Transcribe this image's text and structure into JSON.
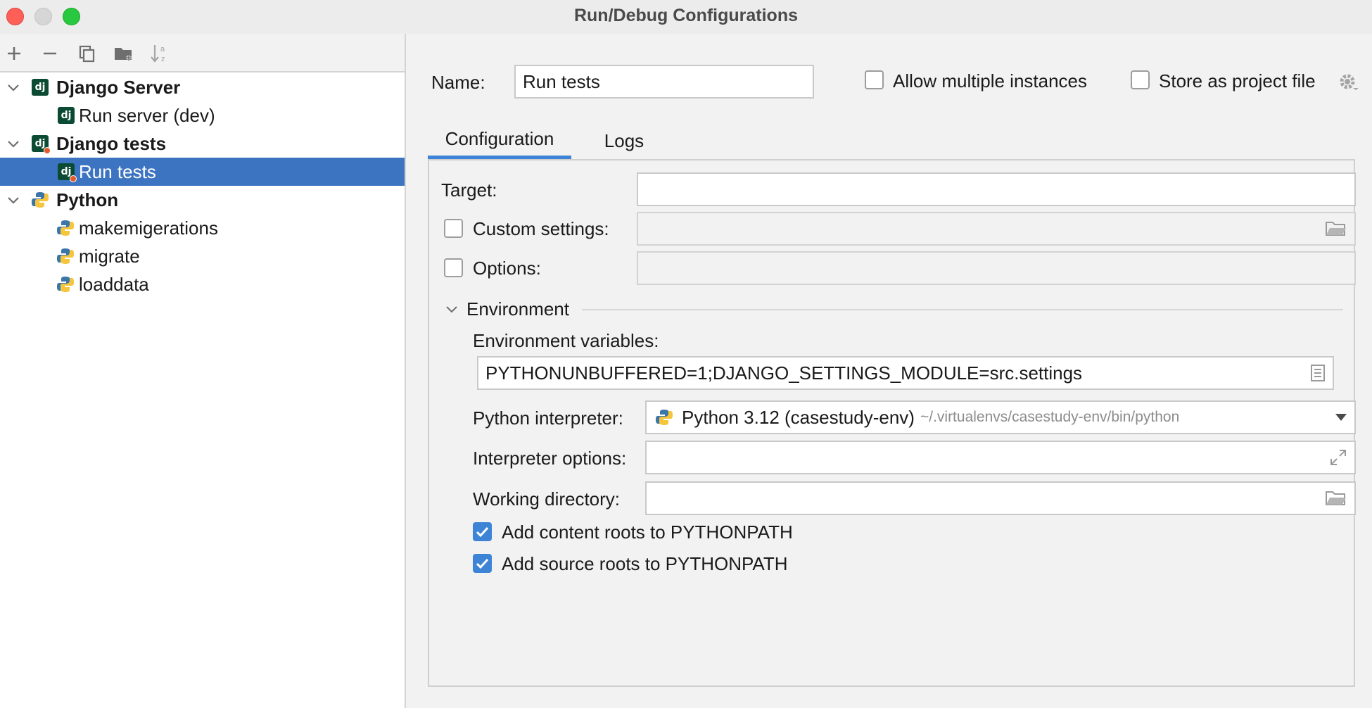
{
  "window": {
    "title": "Run/Debug Configurations"
  },
  "toolbar": {
    "add_icon": "plus-icon",
    "remove_icon": "minus-icon",
    "copy_icon": "copy-icon",
    "folder_icon": "new-folder-icon",
    "sort_icon": "sort-alpha-icon"
  },
  "tree": {
    "groups": [
      {
        "label": "Django Server",
        "icon": "django-icon",
        "items": [
          {
            "label": "Run server (dev)",
            "icon": "django-icon"
          }
        ]
      },
      {
        "label": "Django tests",
        "icon": "django-tests-icon",
        "items": [
          {
            "label": "Run tests",
            "icon": "django-tests-icon",
            "selected": true
          }
        ]
      },
      {
        "label": "Python",
        "icon": "python-icon",
        "items": [
          {
            "label": "makemigerations",
            "icon": "python-icon"
          },
          {
            "label": "migrate",
            "icon": "python-icon"
          },
          {
            "label": "loaddata",
            "icon": "python-icon"
          }
        ]
      }
    ]
  },
  "header": {
    "name_label": "Name:",
    "name_value": "Run tests",
    "allow_multiple_label": "Allow multiple instances",
    "allow_multiple_checked": false,
    "store_project_label": "Store as project file",
    "store_project_checked": false
  },
  "tabs": [
    {
      "label": "Configuration",
      "active": true
    },
    {
      "label": "Logs",
      "active": false
    }
  ],
  "form": {
    "target_label": "Target:",
    "target_value": "",
    "custom_settings_label": "Custom settings:",
    "custom_settings_checked": false,
    "options_label": "Options:",
    "options_checked": false,
    "environment_section": "Environment",
    "env_vars_label": "Environment variables:",
    "env_vars_value": "PYTHONUNBUFFERED=1;DJANGO_SETTINGS_MODULE=src.settings",
    "interpreter_label": "Python interpreter:",
    "interpreter_name": "Python 3.12 (casestudy-env)",
    "interpreter_path": "~/.virtualenvs/casestudy-env/bin/python",
    "interpreter_options_label": "Interpreter options:",
    "working_dir_label": "Working directory:",
    "content_roots_label": "Add content roots to PYTHONPATH",
    "content_roots_checked": true,
    "source_roots_label": "Add source roots to PYTHONPATH",
    "source_roots_checked": true
  },
  "colors": {
    "selection": "#3d74c1",
    "accent": "#3d84d6",
    "django_green": "#0c4b33"
  }
}
